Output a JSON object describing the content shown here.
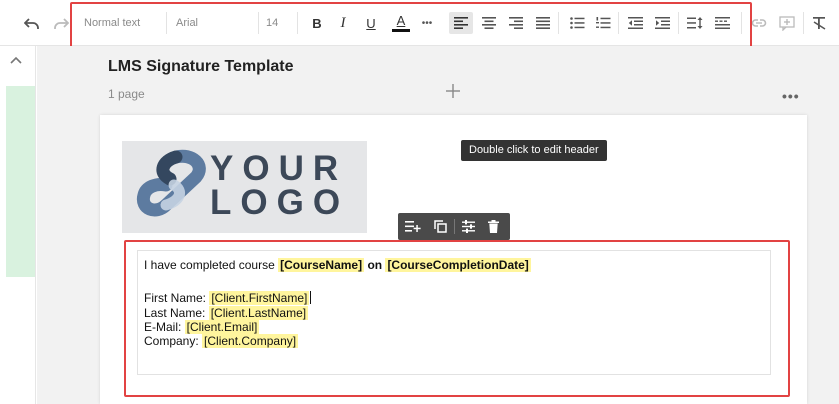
{
  "toolbar": {
    "paragraph_style": "Normal text",
    "font_family": "Arial",
    "font_size": "14",
    "bold_label": "B",
    "italic_label": "I",
    "underline_label": "U",
    "text_color_label": "A",
    "more_label": "•••",
    "icons": [
      "undo-icon",
      "redo-icon",
      "bold-icon",
      "italic-icon",
      "underline-icon",
      "text-color-icon",
      "more-icon",
      "align-left-icon",
      "align-center-icon",
      "align-right-icon",
      "align-justify-icon",
      "bulleted-list-icon",
      "numbered-list-icon",
      "outdent-icon",
      "indent-icon",
      "line-spacing-icon",
      "paragraph-spacing-icon",
      "link-icon",
      "add-comment-icon",
      "clear-format-icon"
    ],
    "text_color": "#111111"
  },
  "document": {
    "title": "LMS Signature Template",
    "page_count": "1 page",
    "more_label": "•••"
  },
  "header": {
    "logo_line1": "YOUR",
    "logo_line2": "LOGO",
    "tooltip": "Double click to edit header"
  },
  "content": {
    "line1_prefix": "I have completed course ",
    "course_name": "[CourseName]",
    "line1_mid": " on ",
    "completion_date": "[CourseCompletionDate]",
    "first_name_label": "First Name: ",
    "first_name_value": "[Client.FirstName]",
    "last_name_label": "Last Name: ",
    "last_name_value": "[Client.LastName]",
    "email_label": "E-Mail: ",
    "email_value": "[Client.Email]",
    "company_label": "Company: ",
    "company_value": "[Client.Company]"
  },
  "colors": {
    "highlight": "#fff59d",
    "annotation_red": "#e24343",
    "rail_green": "#d9f2df",
    "tooltip_bg": "#333333"
  }
}
